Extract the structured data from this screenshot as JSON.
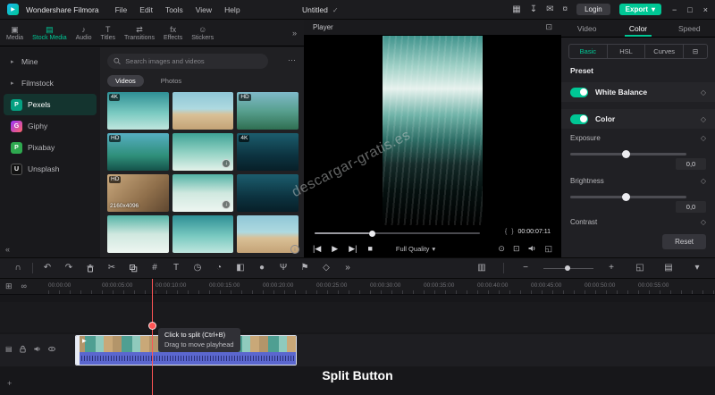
{
  "titlebar": {
    "app_name": "Wondershare Filmora",
    "menus": [
      "File",
      "Edit",
      "Tools",
      "View",
      "Help"
    ],
    "project_title": "Untitled",
    "login_label": "Login",
    "export_label": "Export"
  },
  "media_panel": {
    "tabs": [
      "Media",
      "Stock Media",
      "Audio",
      "Titles",
      "Transitions",
      "Effects",
      "Stickers"
    ],
    "active_tab": "Stock Media",
    "sidebar": [
      {
        "label": "Mine"
      },
      {
        "label": "Filmstock"
      },
      {
        "label": "Pexels",
        "logo": "P"
      },
      {
        "label": "Giphy",
        "logo": "G"
      },
      {
        "label": "Pixabay",
        "logo": "P"
      },
      {
        "label": "Unsplash",
        "logo": "U"
      }
    ],
    "active_sidebar": "Pexels",
    "search_placeholder": "Search images and videos",
    "filters": [
      "Videos",
      "Photos"
    ],
    "active_filter": "Videos",
    "thumbnails": [
      {
        "badge": "4K"
      },
      {
        "badge": ""
      },
      {
        "badge": "HD"
      },
      {
        "badge": "HD"
      },
      {
        "badge": "",
        "dl": true
      },
      {
        "badge": "4K"
      },
      {
        "badge": "HD",
        "res": "2160x4096"
      },
      {
        "badge": "",
        "dl": true
      },
      {
        "badge": ""
      },
      {
        "badge": ""
      },
      {
        "badge": ""
      },
      {
        "badge": ""
      }
    ]
  },
  "player": {
    "title": "Player",
    "current_time": "00:00:07:11",
    "quality": "Full Quality"
  },
  "properties": {
    "tabs": [
      "Video",
      "Color",
      "Speed"
    ],
    "active_tab": "Color",
    "subtabs": [
      "Basic",
      "HSL",
      "Curves"
    ],
    "active_subtab": "Basic",
    "preset_label": "Preset",
    "white_balance_label": "White Balance",
    "color_label": "Color",
    "exposure": {
      "label": "Exposure",
      "value": "0,0"
    },
    "brightness": {
      "label": "Brightness",
      "value": "0,0"
    },
    "contrast_label": "Contrast",
    "reset_label": "Reset"
  },
  "timeline": {
    "ruler": [
      "00:00:00",
      "00:00:05:00",
      "00:00:10:00",
      "00:00:15:00",
      "00:00:20:00",
      "00:00:25:00",
      "00:00:30:00",
      "00:00:35:00",
      "00:00:40:00",
      "00:00:45:00",
      "00:00:50:00",
      "00:00:55:00"
    ],
    "tooltip": {
      "line1": "Click to split (Ctrl+B)",
      "line2": "Drag to move playhead"
    }
  },
  "annotation": {
    "caption": "Split Button"
  },
  "watermark": "descargar-gratis.es",
  "colors": {
    "accent": "#00c795",
    "playhead": "#ff5555",
    "audio_clip": "#5b67cf"
  },
  "icons": {
    "logo_play": "▶",
    "check": "✓",
    "layout": "▦",
    "save": "↧",
    "mail": "✉",
    "store": "¤",
    "minimize": "−",
    "maximize": "□",
    "close": "×",
    "tab_media": "▣",
    "tab_stock": "▤",
    "tab_audio": "♪",
    "tab_titles": "T",
    "tab_transitions": "⇄",
    "tab_effects": "fx",
    "tab_stickers": "☺",
    "chevron_right": "▸",
    "more_tabs": "»",
    "collapse": "«",
    "caret": "▾",
    "dots": "⋯",
    "magnet": "∩",
    "undo": "↶",
    "redo": "↷",
    "split": "✂",
    "crop": "#",
    "text": "T",
    "duration": "◷",
    "speed": "◔",
    "chroma": "◧",
    "record": "●",
    "mic": "Ψ",
    "marker": "⚑",
    "keyframe": "◇",
    "more_tools": "»",
    "render": "▥",
    "zoom_out": "−",
    "zoom_in": "+",
    "fit": "◱",
    "tracks": "▤",
    "panel_caret": "▾",
    "manage_tracks": "⊞",
    "link": "∞",
    "add": "+",
    "download": "↓",
    "info": "i",
    "prev": "|◀",
    "play": "▶",
    "next": "▶|",
    "stop": "■",
    "snapshot": "⊙",
    "display": "⊡",
    "expand": "◱",
    "aspect": "⊡",
    "mark_in": "{",
    "mark_out": "}",
    "diamond": "◇",
    "custom_subtab": "⊟",
    "track_settings": "▤"
  }
}
